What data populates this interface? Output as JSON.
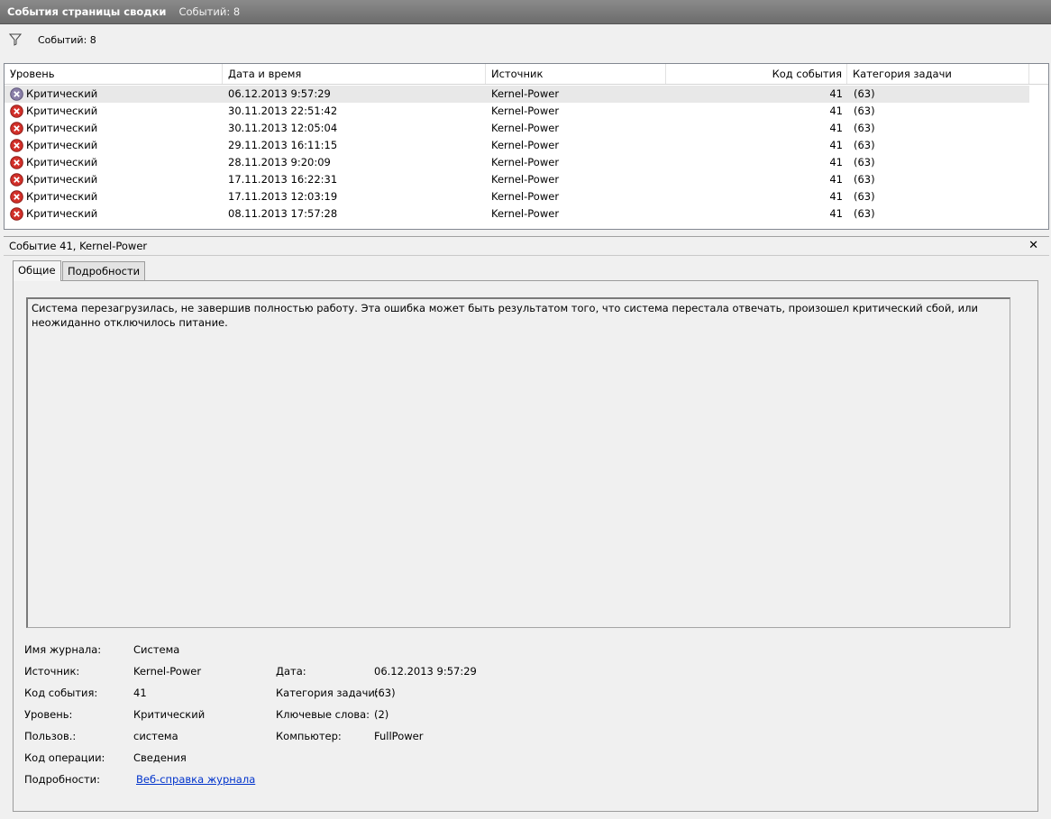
{
  "titlebar": {
    "title": "События страницы сводки",
    "count": "Событий: 8"
  },
  "filterbar": {
    "count": "Событий: 8"
  },
  "grid": {
    "columns": [
      "Уровень",
      "Дата и время",
      "Источник",
      "Код события",
      "Категория задачи"
    ],
    "rows": [
      {
        "level": "Критический",
        "datetime": "06.12.2013 9:57:29",
        "source": "Kernel-Power",
        "code": "41",
        "category": "(63)"
      },
      {
        "level": "Критический",
        "datetime": "30.11.2013 22:51:42",
        "source": "Kernel-Power",
        "code": "41",
        "category": "(63)"
      },
      {
        "level": "Критический",
        "datetime": "30.11.2013 12:05:04",
        "source": "Kernel-Power",
        "code": "41",
        "category": "(63)"
      },
      {
        "level": "Критический",
        "datetime": "29.11.2013 16:11:15",
        "source": "Kernel-Power",
        "code": "41",
        "category": "(63)"
      },
      {
        "level": "Критический",
        "datetime": "28.11.2013 9:20:09",
        "source": "Kernel-Power",
        "code": "41",
        "category": "(63)"
      },
      {
        "level": "Критический",
        "datetime": "17.11.2013 16:22:31",
        "source": "Kernel-Power",
        "code": "41",
        "category": "(63)"
      },
      {
        "level": "Критический",
        "datetime": "17.11.2013 12:03:19",
        "source": "Kernel-Power",
        "code": "41",
        "category": "(63)"
      },
      {
        "level": "Критический",
        "datetime": "08.11.2013 17:57:28",
        "source": "Kernel-Power",
        "code": "41",
        "category": "(63)"
      }
    ]
  },
  "detail": {
    "header": "Событие 41, Kernel-Power",
    "tabs": [
      "Общие",
      "Подробности"
    ],
    "description": "Система перезагрузилась, не завершив полностью работу. Эта ошибка может быть результатом того, что система перестала отвечать, произошел критический сбой, или неожиданно отключилось питание.",
    "props": {
      "log_name_label": "Имя журнала:",
      "log_name": "Система",
      "source_label": "Источник:",
      "source": "Kernel-Power",
      "date_label": "Дата:",
      "date": "06.12.2013 9:57:29",
      "event_id_label": "Код события:",
      "event_id": "41",
      "task_category_label": "Категория задачи:",
      "task_category": "(63)",
      "level_label": "Уровень:",
      "level": "Критический",
      "keywords_label": "Ключевые слова:",
      "keywords": "(2)",
      "user_label": "Пользов.:",
      "user": "система",
      "computer_label": "Компьютер:",
      "computer": "FullPower",
      "opcode_label": "Код операции:",
      "opcode": "Сведения",
      "more_label": "Подробности:",
      "more_link": "Веб-справка журнала"
    }
  }
}
